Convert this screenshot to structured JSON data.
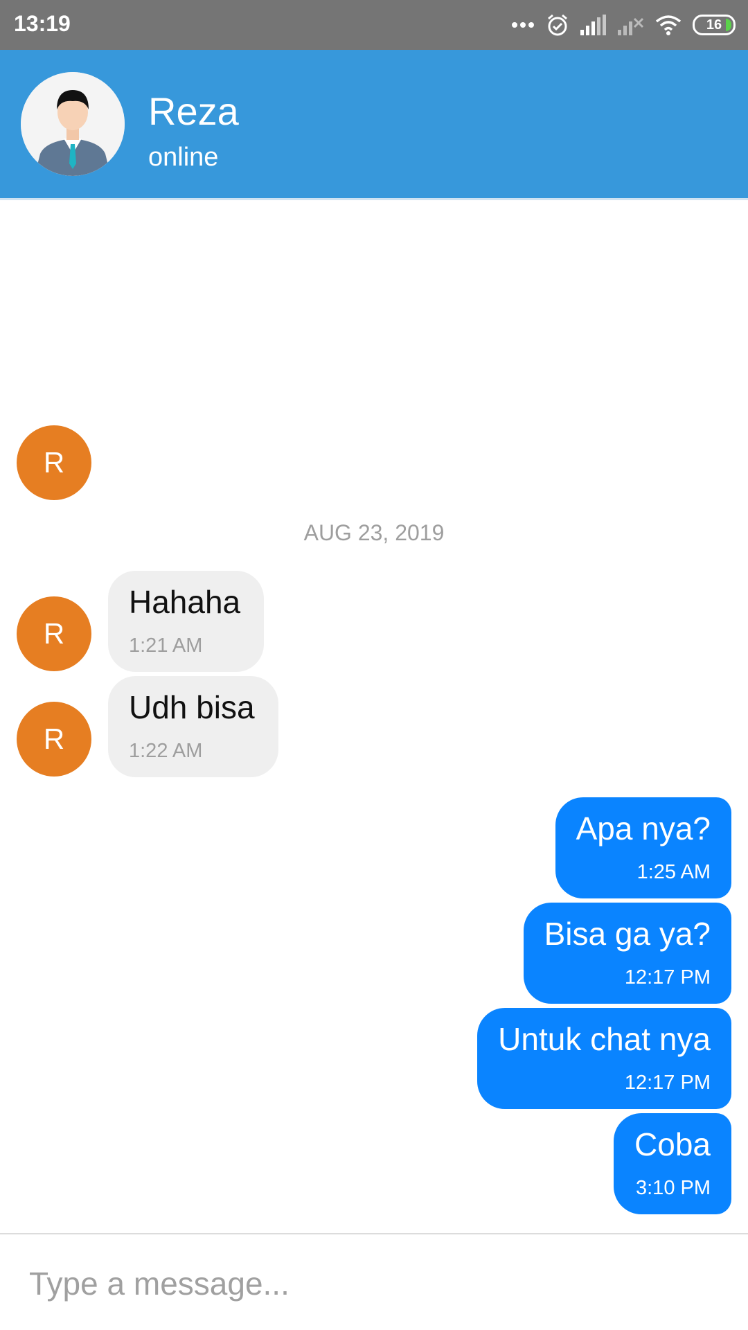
{
  "status_bar": {
    "time": "13:19",
    "battery": "16",
    "icons": [
      "more-dots-icon",
      "alarm-icon",
      "signal-icon",
      "signal-off-icon",
      "wifi-icon",
      "battery-icon"
    ]
  },
  "header": {
    "name": "Reza",
    "status": "online"
  },
  "chat": {
    "avatar_letter": "R",
    "date_separator": "AUG 23, 2019",
    "incoming": [
      {
        "text": "Hahaha",
        "time": "1:21 AM"
      },
      {
        "text": "Udh bisa",
        "time": "1:22 AM"
      }
    ],
    "outgoing": [
      {
        "text": "Apa nya?",
        "time": "1:25 AM"
      },
      {
        "text": "Bisa ga ya?",
        "time": "12:17 PM"
      },
      {
        "text": "Untuk chat nya",
        "time": "12:17 PM"
      },
      {
        "text": "Coba",
        "time": "3:10 PM"
      }
    ]
  },
  "composer": {
    "placeholder": "Type a message..."
  },
  "colors": {
    "header": "#3798db",
    "avatar_orange": "#e67e22",
    "outgoing_bubble": "#0a84ff",
    "incoming_bubble": "#efefef"
  }
}
